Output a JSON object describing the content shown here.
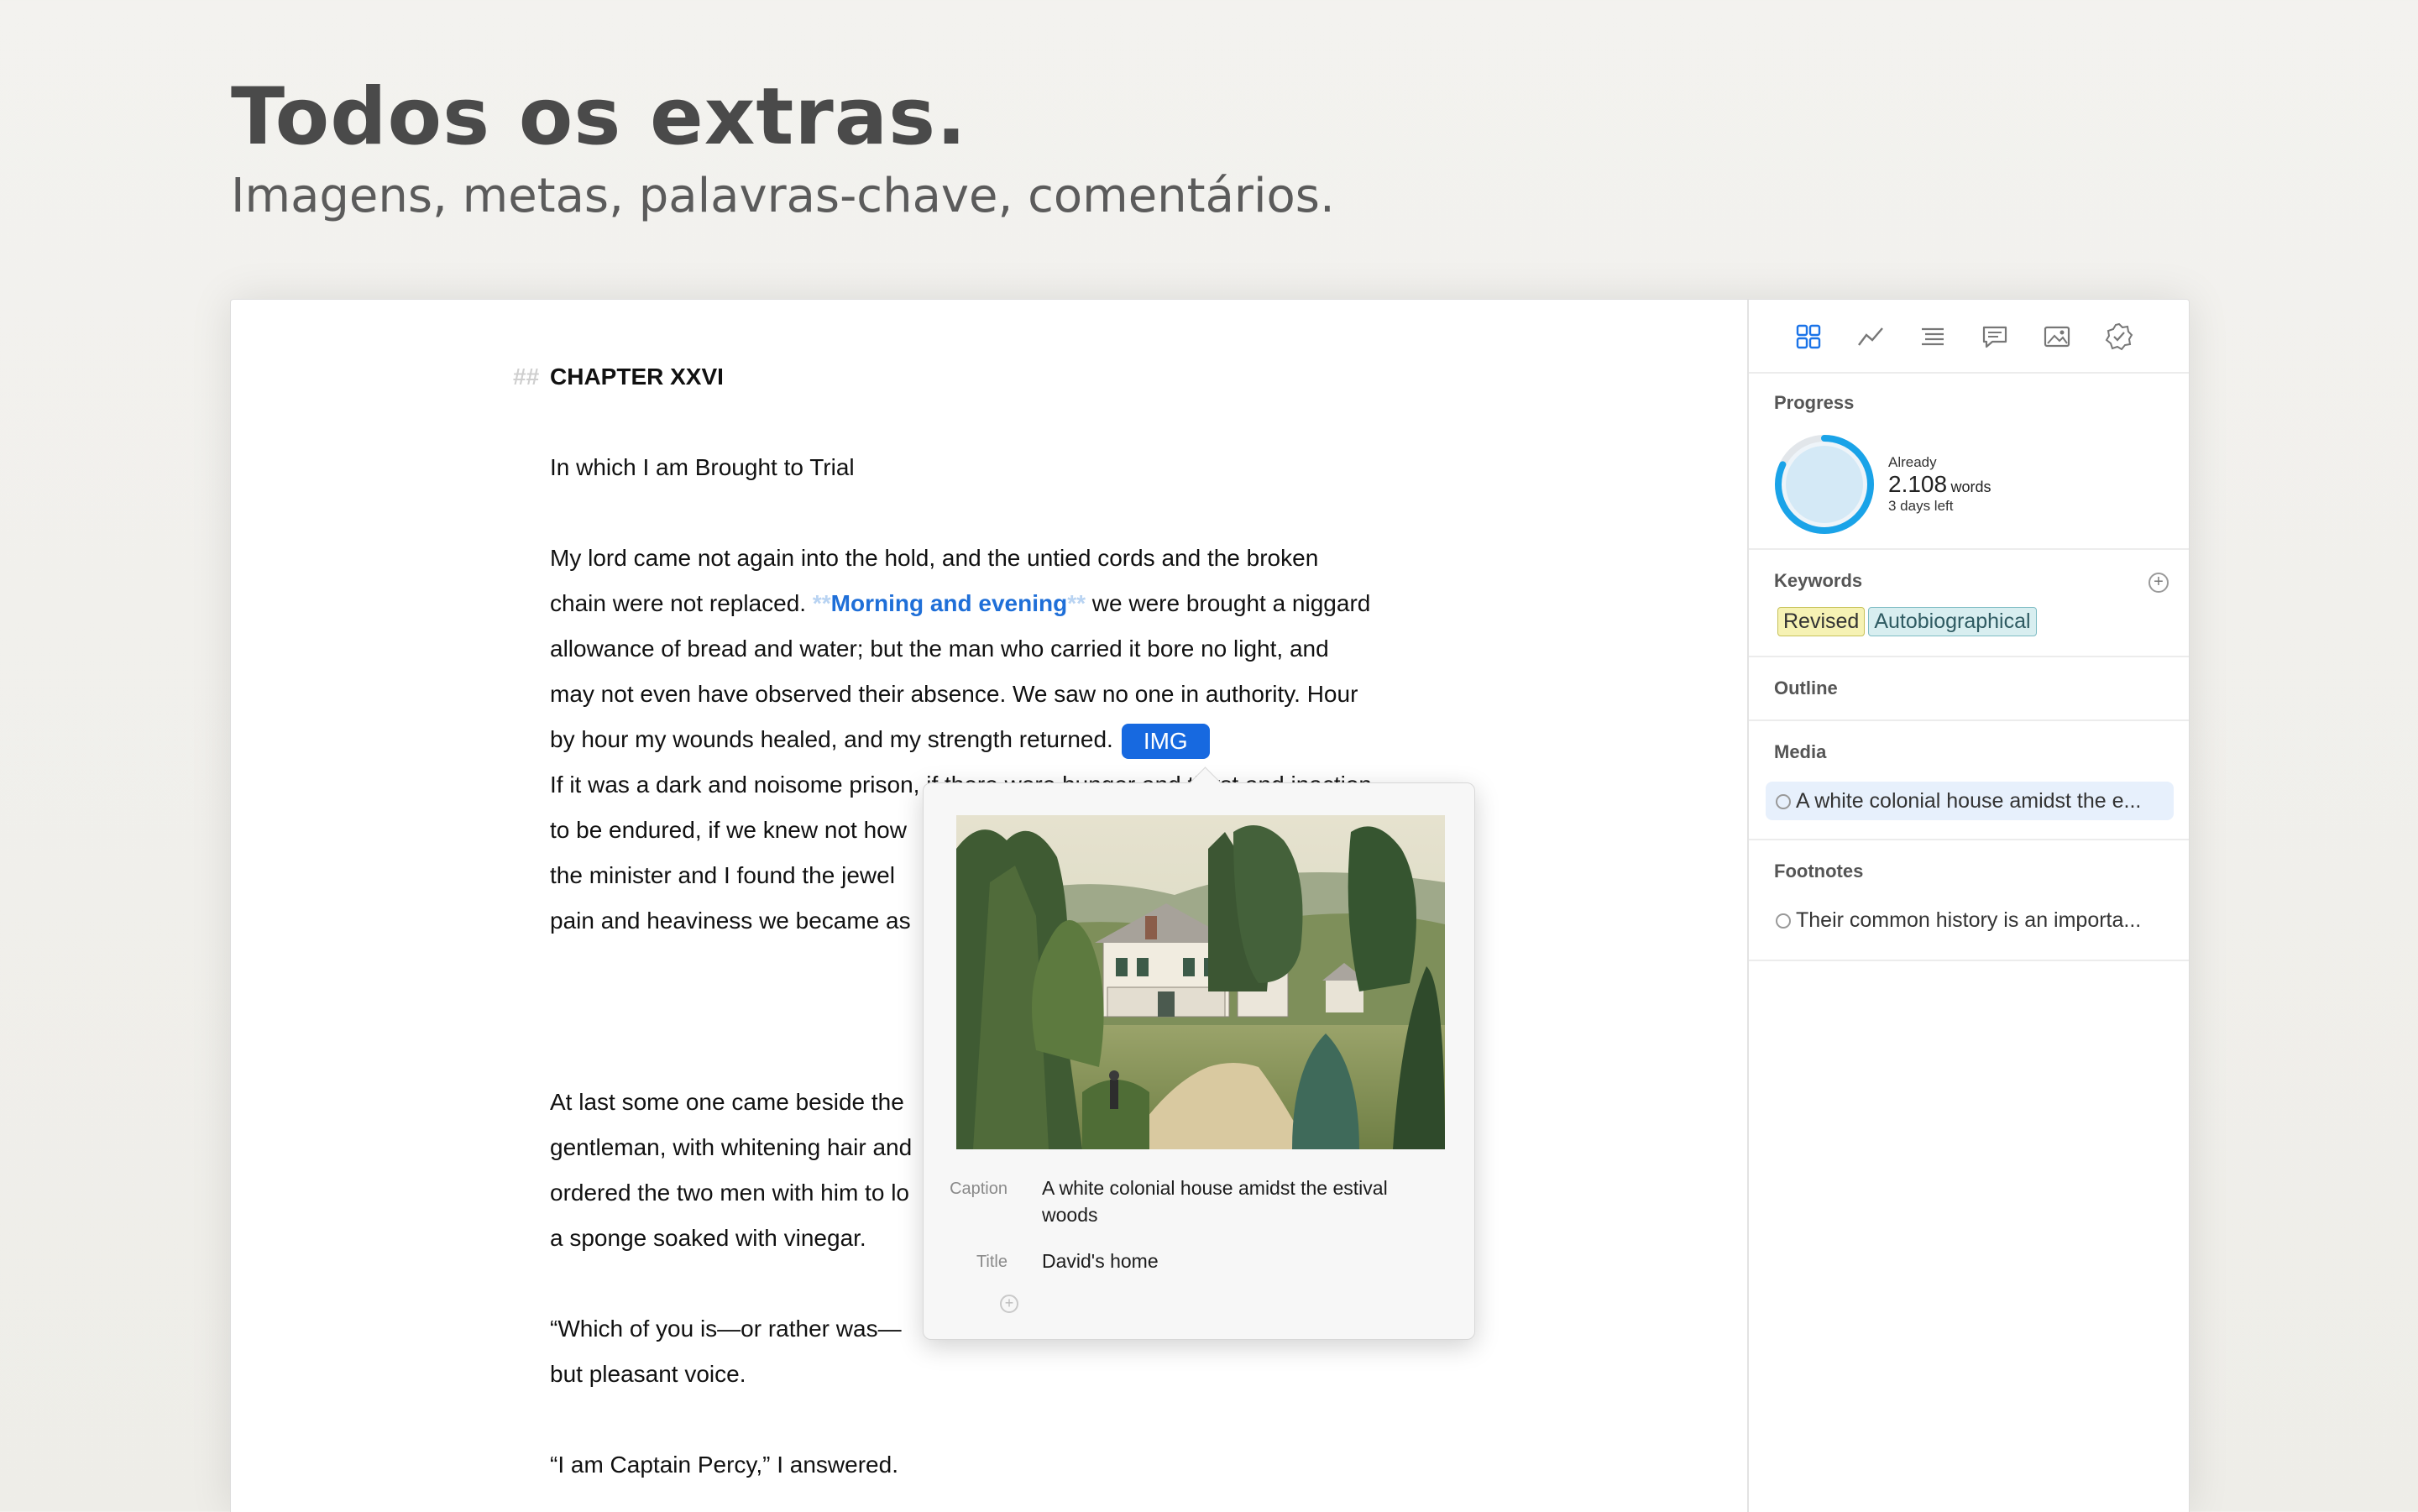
{
  "hero": {
    "title": "Todos os extras.",
    "subtitle": "Imagens, metas, palavras-chave, comentários."
  },
  "editor": {
    "heading_marker": "##",
    "heading": "CHAPTER XXVI",
    "subheading": "In which I am Brought to Trial",
    "p1": {
      "line1": "My lord came not again into the hold, and the untied cords and the broken",
      "line2_pre": "chain were not replaced. ",
      "bold_marker_open": "**",
      "bold_text": "Morning and evening",
      "bold_marker_close": "**",
      "line2_post": " we were brought a niggard",
      "line3": "allowance of bread and water; but the man who carried it bore no light, and",
      "line4": "may not even have observed their absence. We saw no one in authority. Hour",
      "line5": "by hour my wounds healed, and my strength returned.",
      "img_tag": "IMG"
    },
    "p2": {
      "line1": "If it was a dark and noisome prison, if there were hunger and thirst and inaction",
      "line2": "to be endured, if we knew not how",
      "line3": "the minister and I found the jewel",
      "line4": "pain and heaviness we became as"
    },
    "p3": {
      "line1": "At last some one came beside the",
      "line2": "gentleman, with whitening hair and",
      "line3": "ordered the two men with him to lo",
      "line4": "a sponge soaked with vinegar."
    },
    "p4": {
      "line1": "“Which of you is—or rather was—",
      "line2": "but pleasant voice."
    },
    "p5": "“I am Captain Percy,” I answered."
  },
  "popover": {
    "caption_label": "Caption",
    "caption_value": "A white colonial house amidst the estival woods",
    "title_label": "Title",
    "title_value": "David's home",
    "add_icon": "plus-circle-icon"
  },
  "sidebar": {
    "tabs": [
      "overview-icon",
      "statistics-icon",
      "outline-icon",
      "comments-icon",
      "media-icon",
      "check-badge-icon"
    ],
    "progress": {
      "title": "Progress",
      "already_label": "Already",
      "count": "2.108",
      "unit": "words",
      "days_left": "3 days left",
      "percent": 0.82,
      "ring_color": "#1aa3e8",
      "ring_fill": "#d4e9f6"
    },
    "keywords": {
      "title": "Keywords",
      "items": [
        "Revised",
        "Autobiographical"
      ]
    },
    "outline": {
      "title": "Outline"
    },
    "media": {
      "title": "Media",
      "items": [
        "A white colonial house amidst the e..."
      ]
    },
    "footnotes": {
      "title": "Footnotes",
      "items": [
        "Their common history is an importa..."
      ]
    }
  }
}
